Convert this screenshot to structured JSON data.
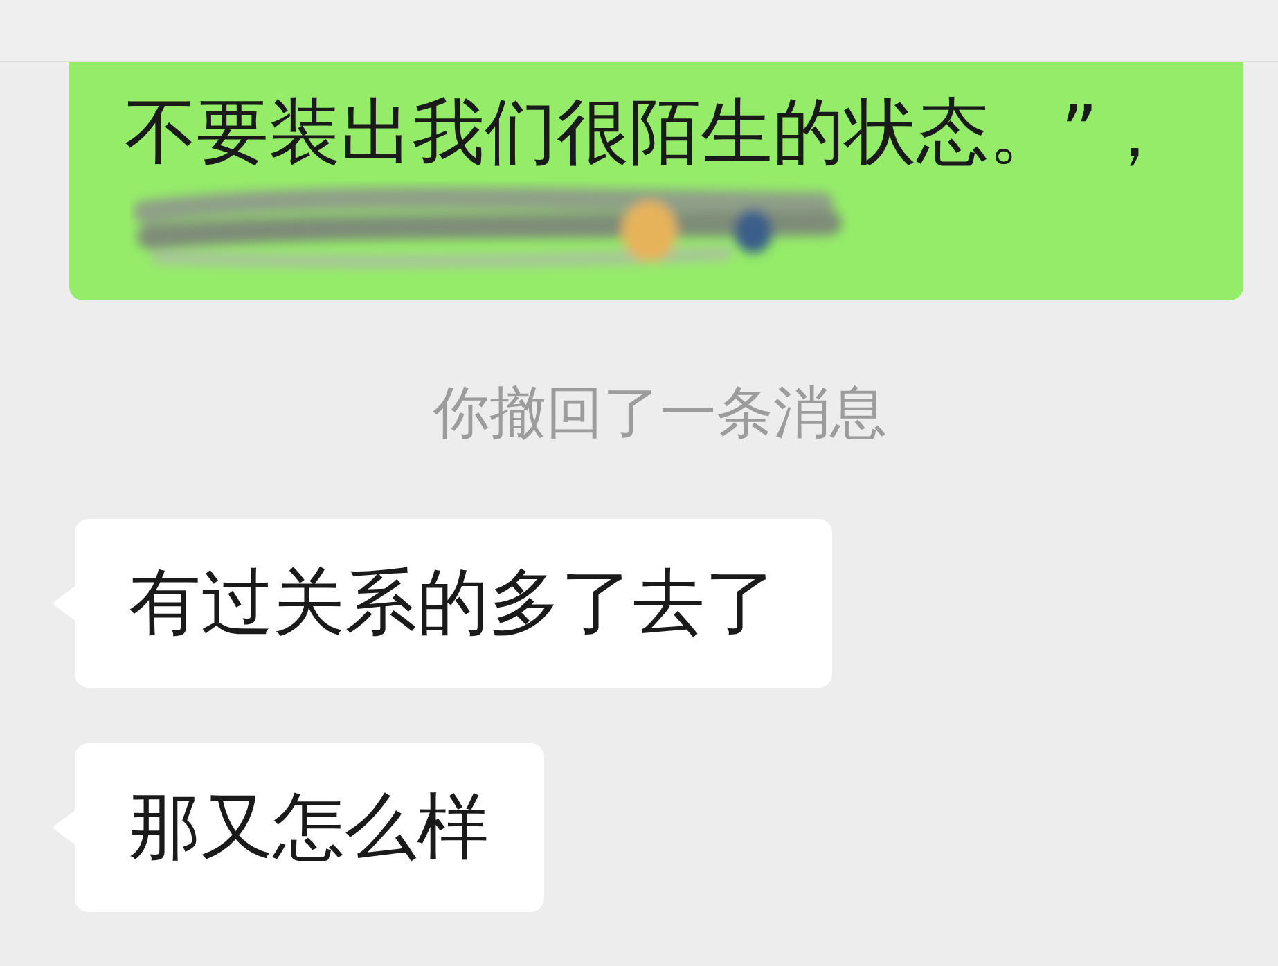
{
  "messages": [
    {
      "kind": "sent",
      "text": "不要装出我们很陌生的状态。”，",
      "redacted": true
    },
    {
      "kind": "system",
      "text": "你撤回了一条消息"
    },
    {
      "kind": "received",
      "text": "有过关系的多了去了"
    },
    {
      "kind": "received",
      "text": "那又怎么样"
    }
  ]
}
